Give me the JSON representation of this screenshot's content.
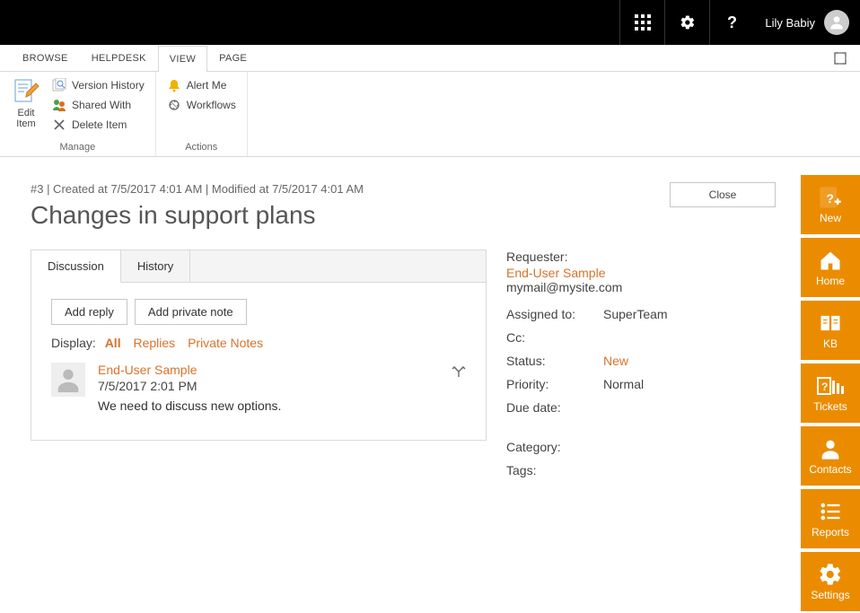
{
  "topbar": {
    "user_name": "Lily Babiy"
  },
  "ribbon_tabs": [
    "BROWSE",
    "HELPDESK",
    "VIEW",
    "PAGE"
  ],
  "ribbon_tabs_active": 2,
  "ribbon": {
    "edit_item": "Edit\nItem",
    "version_history": "Version History",
    "shared_with": "Shared With",
    "delete_item": "Delete Item",
    "manage_label": "Manage",
    "alert_me": "Alert Me",
    "workflows": "Workflows",
    "actions_label": "Actions"
  },
  "page": {
    "meta": "#3 | Created at 7/5/2017 4:01 AM | Modified at 7/5/2017 4:01 AM",
    "title": "Changes in support plans",
    "close": "Close"
  },
  "card": {
    "tabs": {
      "discussion": "Discussion",
      "history": "History"
    },
    "add_reply": "Add reply",
    "add_private_note": "Add private note",
    "display_label": "Display:",
    "filters": {
      "all": "All",
      "replies": "Replies",
      "private": "Private Notes"
    },
    "post": {
      "author": "End-User Sample",
      "timestamp": "7/5/2017 2:01 PM",
      "body": "We need to discuss new options."
    }
  },
  "details": {
    "requester_label": "Requester:",
    "requester_name": "End-User Sample",
    "requester_email": "mymail@mysite.com",
    "assigned_label": "Assigned to:",
    "assigned_value": "SuperTeam",
    "cc_label": "Cc:",
    "cc_value": "",
    "status_label": "Status:",
    "status_value": "New",
    "priority_label": "Priority:",
    "priority_value": "Normal",
    "due_label": "Due date:",
    "due_value": "",
    "category_label": "Category:",
    "category_value": "",
    "tags_label": "Tags:",
    "tags_value": ""
  },
  "rail": {
    "new": "New",
    "home": "Home",
    "kb": "KB",
    "tickets": "Tickets",
    "contacts": "Contacts",
    "reports": "Reports",
    "settings": "Settings"
  }
}
